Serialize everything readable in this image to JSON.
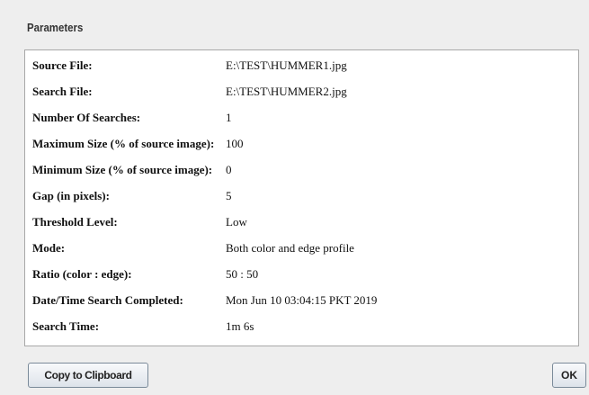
{
  "section_title": "Parameters",
  "parameters": [
    {
      "label": "Source File:",
      "value": "E:\\TEST\\HUMMER1.jpg"
    },
    {
      "label": "Search File:",
      "value": "E:\\TEST\\HUMMER2.jpg"
    },
    {
      "label": "Number Of Searches:",
      "value": "1"
    },
    {
      "label": "Maximum Size (% of source image):",
      "value": "100"
    },
    {
      "label": "Minimum Size (% of source image):",
      "value": "0"
    },
    {
      "label": "Gap (in pixels):",
      "value": "5"
    },
    {
      "label": "Threshold Level:",
      "value": "Low"
    },
    {
      "label": "Mode:",
      "value": "Both color and edge profile"
    },
    {
      "label": "Ratio (color : edge):",
      "value": "50 : 50"
    },
    {
      "label": "Date/Time Search Completed:",
      "value": "Mon Jun 10 03:04:15 PKT 2019"
    },
    {
      "label": "Search Time:",
      "value": "1m 6s"
    }
  ],
  "buttons": {
    "copy_label": "Copy to Clipboard",
    "ok_label": "OK"
  }
}
